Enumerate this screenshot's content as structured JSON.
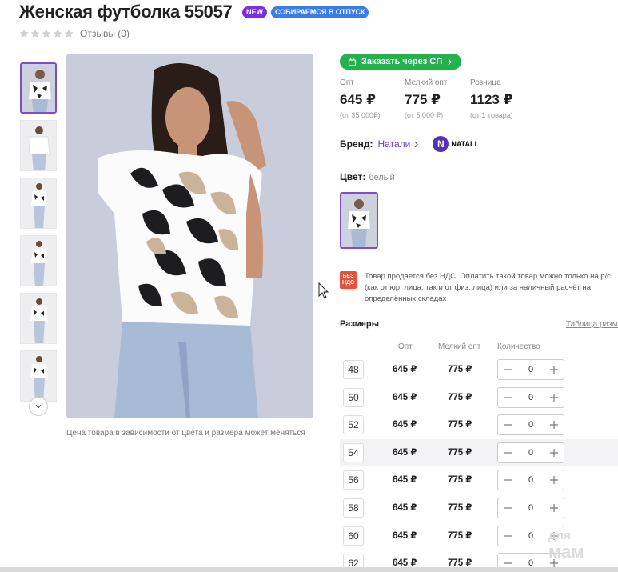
{
  "product": {
    "title": "Женская футболка 55057",
    "badges": [
      "NEW",
      "СОБИРАЕМСЯ В ОТПУСК"
    ],
    "reviews_label": "Отзывы (0)",
    "rating_stars": 0,
    "photo_note": "Цена товара в зависимости от цвета и размера может меняться"
  },
  "sp_button_label": "Заказать через СП",
  "prices": [
    {
      "label": "Опт",
      "value": "645 ₽",
      "note": "(от 35 000₽)"
    },
    {
      "label": "Мелкий опт",
      "value": "775 ₽",
      "note": "(от 5 000 ₽)"
    },
    {
      "label": "Розница",
      "value": "1123 ₽",
      "note": "(от 1 товара)"
    }
  ],
  "brand": {
    "label": "Бренд:",
    "name": "Натали",
    "logo_letter": "N",
    "logo_text": "NATALI"
  },
  "color": {
    "label": "Цвет:",
    "value": "белый"
  },
  "vat": {
    "icon_text": "БЕЗ НДС",
    "text": "Товар продается без НДС. Оплатить такой товар можно только на р/с (как от юр. лица, так и от физ. лица) или за наличный расчёт на определённых складах"
  },
  "sizes": {
    "title": "Размеры",
    "table_link": "Таблица размеров",
    "columns": [
      "Опт",
      "Мелкий опт",
      "Количество"
    ],
    "rows": [
      {
        "size": "48",
        "opt": "645 ₽",
        "small_opt": "775 ₽",
        "qty": "0"
      },
      {
        "size": "50",
        "opt": "645 ₽",
        "small_opt": "775 ₽",
        "qty": "0"
      },
      {
        "size": "52",
        "opt": "645 ₽",
        "small_opt": "775 ₽",
        "qty": "0"
      },
      {
        "size": "54",
        "opt": "645 ₽",
        "small_opt": "775 ₽",
        "qty": "0"
      },
      {
        "size": "56",
        "opt": "645 ₽",
        "small_opt": "775 ₽",
        "qty": "0"
      },
      {
        "size": "58",
        "opt": "645 ₽",
        "small_opt": "775 ₽",
        "qty": "0"
      },
      {
        "size": "60",
        "opt": "645 ₽",
        "small_opt": "775 ₽",
        "qty": "0"
      },
      {
        "size": "62",
        "opt": "645 ₽",
        "small_opt": "775 ₽",
        "qty": "0"
      }
    ]
  },
  "watermark": {
    "line1": "для",
    "line2": "мам"
  },
  "colors": {
    "accent": "#7b4fc9",
    "green": "#22b14c",
    "new_badge": "#7b2fe0",
    "vacation_badge": "#3b7de8",
    "vat_icon": "#e6533d"
  },
  "icons": [
    "star-icon",
    "chevron-down-icon",
    "cart-icon",
    "chevron-right-icon",
    "minus-icon",
    "plus-icon",
    "mouse-cursor-icon"
  ]
}
